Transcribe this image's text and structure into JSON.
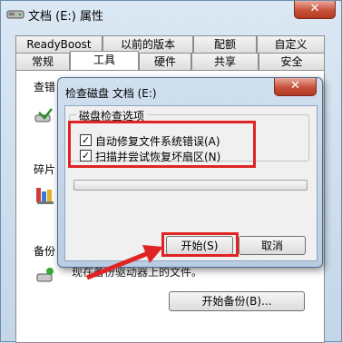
{
  "window": {
    "title": "文档 (E:) 属性",
    "close_label": "✕"
  },
  "tabs_row1": [
    {
      "label": "ReadyBoost"
    },
    {
      "label": "以前的版本"
    },
    {
      "label": "配额"
    },
    {
      "label": "自定义"
    }
  ],
  "tabs_row2": [
    {
      "label": "常规",
      "selected": false
    },
    {
      "label": "工具",
      "selected": true
    },
    {
      "label": "硬件",
      "selected": false
    },
    {
      "label": "共享",
      "selected": false
    },
    {
      "label": "安全",
      "selected": false
    }
  ],
  "panel": {
    "check_group_label": "查错",
    "defrag_group_label": "碎片",
    "backup_group_label": "备份",
    "backup_text": "现在备份驱动器上的文件。",
    "backup_button": "开始备份(B)..."
  },
  "dialog": {
    "title": "检查磁盘 文档 (E:)",
    "close_label": "✕",
    "legend": "磁盘检查选项",
    "options": [
      {
        "label": "自动修复文件系统错误(A)",
        "checked": true
      },
      {
        "label": "扫描并尝试恢复坏扇区(N)",
        "checked": true
      }
    ],
    "progress": 0,
    "start_button": "开始(S)",
    "cancel_button": "取消"
  },
  "colors": {
    "annotation": "#e02424",
    "close_button": "#c8513b"
  }
}
